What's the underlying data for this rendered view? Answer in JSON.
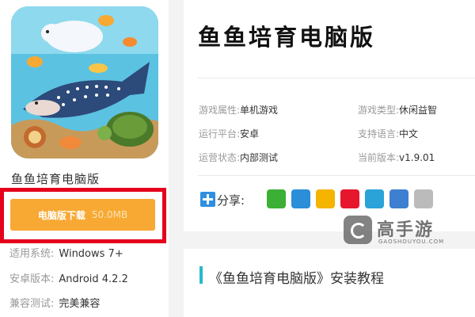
{
  "game": {
    "name": "鱼鱼培育电脑版",
    "download_label": "电脑版下载",
    "download_size": "50.0MB"
  },
  "left_meta": [
    {
      "label": "适用系统:",
      "value": "Windows 7+"
    },
    {
      "label": "安卓版本:",
      "value": "Android 4.2.2"
    },
    {
      "label": "兼容测试:",
      "value": "完美兼容"
    }
  ],
  "info": [
    {
      "label": "游戏属性:",
      "value": "单机游戏"
    },
    {
      "label": "游戏类型:",
      "value": "休闲益智"
    },
    {
      "label": "运行平台:",
      "value": "安卓"
    },
    {
      "label": "支持语言:",
      "value": "中文"
    },
    {
      "label": "运营状态:",
      "value": "内部测试"
    },
    {
      "label": "当前版本:",
      "value": "v1.9.01"
    }
  ],
  "share": {
    "label": "分享:",
    "icons": [
      "wechat-icon",
      "qq-icon",
      "qzone-icon",
      "weibo-icon",
      "tencent-weibo-icon",
      "print-icon",
      "copy-icon"
    ],
    "colors": [
      "#3cb034",
      "#2a8ed8",
      "#f5b400",
      "#e6162d",
      "#2aa3d8",
      "#3d7fd0",
      "#bbbbbb"
    ]
  },
  "watermark": {
    "name": "高手游",
    "site": "GAOSHOUYOU.COM"
  },
  "section": {
    "title": "《鱼鱼培育电脑版》安装教程"
  },
  "colors": {
    "download_button": "#f7a934",
    "highlight_border": "#e5001c",
    "section_accent": "#29b9c9"
  }
}
